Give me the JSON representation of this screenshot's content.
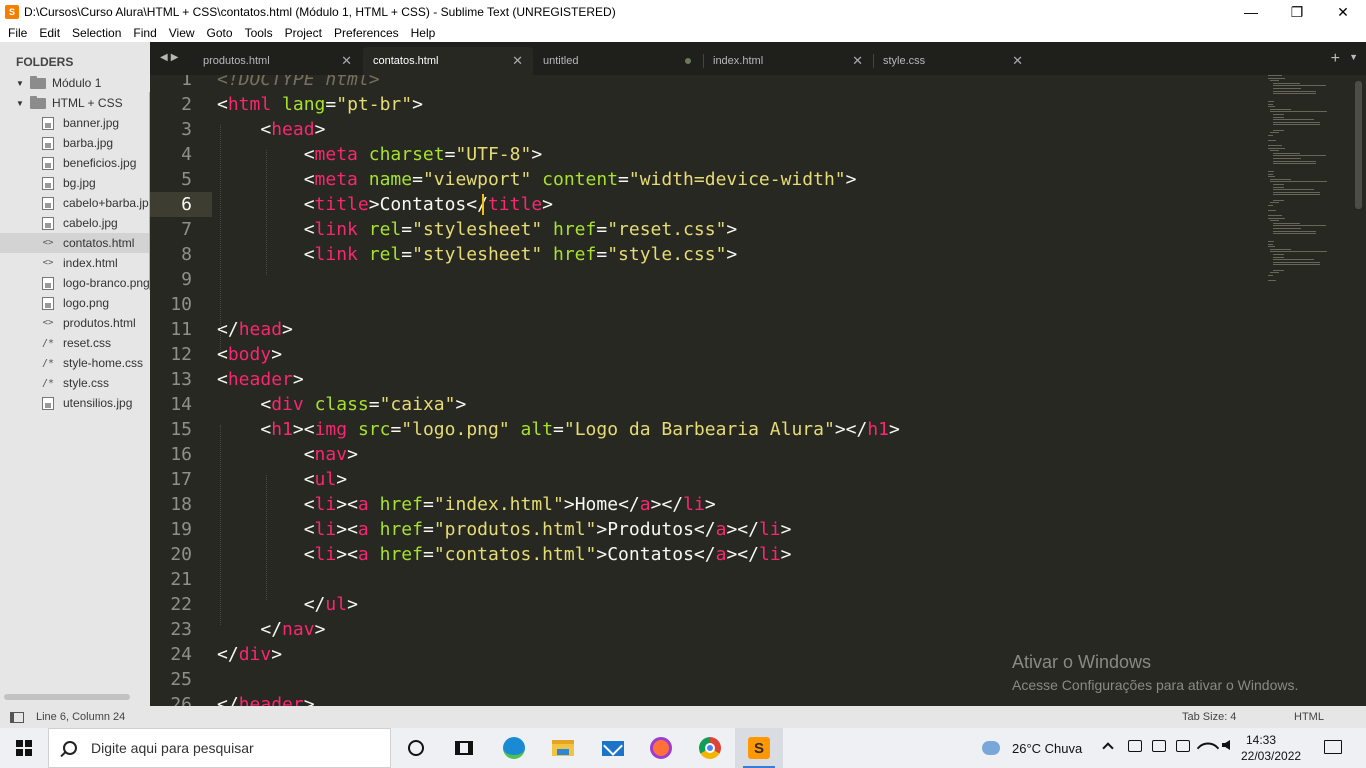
{
  "window": {
    "title": "D:\\Cursos\\Curso Alura\\HTML + CSS\\contatos.html (Módulo 1, HTML + CSS) - Sublime Text (UNREGISTERED)",
    "minimize": "—",
    "maximize": "❐",
    "close": "✕"
  },
  "menu": [
    "File",
    "Edit",
    "Selection",
    "Find",
    "View",
    "Goto",
    "Tools",
    "Project",
    "Preferences",
    "Help"
  ],
  "sidebar": {
    "title": "FOLDERS",
    "folders": [
      {
        "label": "Módulo 1"
      },
      {
        "label": "HTML + CSS"
      }
    ],
    "files": [
      {
        "label": "banner.jpg",
        "icon": "image-file-icon"
      },
      {
        "label": "barba.jpg",
        "icon": "image-file-icon"
      },
      {
        "label": "beneficios.jpg",
        "icon": "image-file-icon"
      },
      {
        "label": "bg.jpg",
        "icon": "image-file-icon"
      },
      {
        "label": "cabelo+barba.jp",
        "icon": "image-file-icon"
      },
      {
        "label": "cabelo.jpg",
        "icon": "image-file-icon"
      },
      {
        "label": "contatos.html",
        "icon": "code-file-icon",
        "selected": true
      },
      {
        "label": "index.html",
        "icon": "code-file-icon"
      },
      {
        "label": "logo-branco.png",
        "icon": "image-file-icon"
      },
      {
        "label": "logo.png",
        "icon": "image-file-icon"
      },
      {
        "label": "produtos.html",
        "icon": "code-file-icon"
      },
      {
        "label": "reset.css",
        "icon": "css-file-icon"
      },
      {
        "label": "style-home.css",
        "icon": "css-file-icon"
      },
      {
        "label": "style.css",
        "icon": "css-file-icon"
      },
      {
        "label": "utensilios.jpg",
        "icon": "image-file-icon"
      }
    ]
  },
  "tabs": [
    {
      "label": "produtos.html",
      "active": false
    },
    {
      "label": "contatos.html",
      "active": true
    },
    {
      "label": "untitled",
      "active": false,
      "dirty": true
    },
    {
      "label": "index.html",
      "active": false
    },
    {
      "label": "style.css",
      "active": false
    }
  ],
  "editor": {
    "current_line": 6,
    "lines": [
      "<!DOCTYPE html>",
      "<html lang=\"pt-br\">",
      "    <head>",
      "        <meta charset=\"UTF-8\">",
      "        <meta name=\"viewport\" content=\"width=device-width\">",
      "        <title>Contatos</title>",
      "        <link rel=\"stylesheet\" href=\"reset.css\">",
      "        <link rel=\"stylesheet\" href=\"style.css\">",
      "",
      "",
      "</head>",
      "<body>",
      "<header>",
      "    <div class=\"caixa\">",
      "    <h1><img src=\"logo.png\" alt=\"Logo da Barbearia Alura\"></h1>",
      "        <nav>",
      "        <ul>",
      "        <li><a href=\"index.html\">Home</a></li>",
      "        <li><a href=\"produtos.html\">Produtos</a></li>",
      "        <li><a href=\"contatos.html\">Contatos</a></li>",
      "",
      "        </ul>",
      "    </nav>",
      "</div>",
      "",
      "</header>"
    ]
  },
  "watermark": {
    "title": "Ativar o Windows",
    "subtitle": "Acesse Configurações para ativar o Windows."
  },
  "statusbar": {
    "position": "Line 6, Column 24",
    "tab_size": "Tab Size: 4",
    "syntax": "HTML"
  },
  "taskbar": {
    "search_placeholder": "Digite aqui para pesquisar",
    "weather": "26°C  Chuva",
    "time": "14:33",
    "date": "22/03/2022"
  },
  "colors": {
    "editor_bg": "#272822",
    "tag": "#f92672",
    "attribute": "#a6e22e",
    "string": "#e6db74",
    "text": "#f8f8f2",
    "cursor": "#f8c000"
  }
}
